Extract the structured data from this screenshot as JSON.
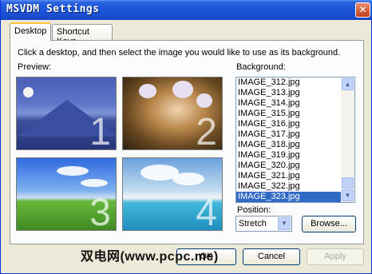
{
  "window": {
    "title": "MSVDM Settings",
    "close_glyph": "✕"
  },
  "tabs": [
    {
      "label": "Desktop",
      "active": true
    },
    {
      "label": "Shortcut Keys",
      "active": false
    }
  ],
  "desktop_tab": {
    "instructions": "Click a desktop, and then select the image you would like to use as its background.",
    "preview_label": "Preview:",
    "previews": [
      {
        "number": "1",
        "scene": "mountain-night"
      },
      {
        "number": "2",
        "scene": "orchids"
      },
      {
        "number": "3",
        "scene": "green-hills"
      },
      {
        "number": "4",
        "scene": "tropical-beach"
      }
    ],
    "background_label": "Background:",
    "background_list": [
      "IMAGE_312.jpg",
      "IMAGE_313.jpg",
      "IMAGE_314.jpg",
      "IMAGE_315.jpg",
      "IMAGE_316.jpg",
      "IMAGE_317.jpg",
      "IMAGE_318.jpg",
      "IMAGE_319.jpg",
      "IMAGE_320.jpg",
      "IMAGE_321.jpg",
      "IMAGE_322.jpg",
      "IMAGE_323.jpg"
    ],
    "selected_background": "IMAGE_323.jpg",
    "position_label": "Position:",
    "position_value": "Stretch",
    "browse_label": "Browse..."
  },
  "footer": {
    "ok_label": "OK",
    "cancel_label": "Cancel",
    "apply_label": "Apply",
    "apply_enabled": false
  },
  "watermark": "双电网(www.pcpc.me)",
  "colors": {
    "titlebar": "#1b55d8",
    "selection": "#316ac5",
    "tab_highlight": "#ffc83c"
  }
}
